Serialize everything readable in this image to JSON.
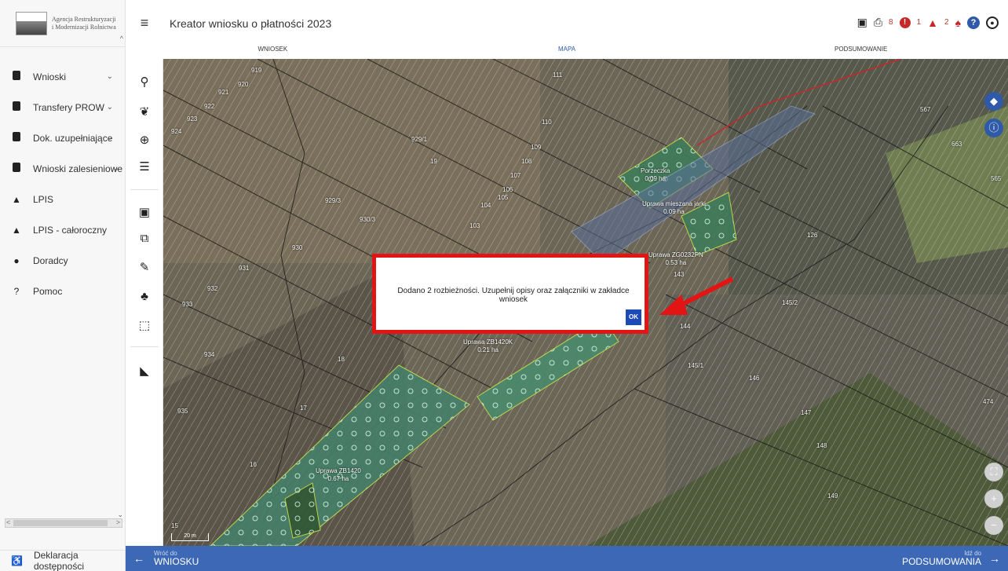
{
  "app": {
    "logo_line1": "Agencja Restrukturyzacji",
    "logo_line2": "i Modernizacji Rolnictwa",
    "page_title": "Kreator wniosku o płatności 2023"
  },
  "sidebar": {
    "items": [
      {
        "label": "Wnioski",
        "icon": "document-icon",
        "has_dropdown": true
      },
      {
        "label": "Transfery PROW",
        "icon": "document-icon",
        "has_dropdown": true
      },
      {
        "label": "Dok. uzupełniające",
        "icon": "document-icon",
        "has_dropdown": true
      },
      {
        "label": "Wnioski zalesieniowe",
        "icon": "document-icon",
        "has_dropdown": true
      },
      {
        "label": "LPIS",
        "icon": "terrain-icon",
        "has_dropdown": false
      },
      {
        "label": "LPIS - całoroczny",
        "icon": "terrain-icon",
        "has_dropdown": false
      },
      {
        "label": "Doradcy",
        "icon": "person-icon",
        "has_dropdown": false
      },
      {
        "label": "Pomoc",
        "icon": "help-icon",
        "has_dropdown": false
      }
    ],
    "footer_link": "Deklaracja dostępności"
  },
  "header": {
    "errors_count": "8",
    "warnings_count": "1",
    "notifications_count": "2"
  },
  "tabs": [
    {
      "label": "WNIOSEK",
      "active": false
    },
    {
      "label": "MAPA",
      "active": true
    },
    {
      "label": "PODSUMOWANIE",
      "active": false
    }
  ],
  "map": {
    "scale": "20 m",
    "parcel_labels": [
      "919",
      "920",
      "921",
      "922",
      "923",
      "924",
      "929/1",
      "111",
      "110",
      "109",
      "108",
      "107",
      "106",
      "105",
      "104",
      "103",
      "19",
      "929/3",
      "930/3",
      "930",
      "931",
      "932",
      "933",
      "934",
      "935",
      "18",
      "17",
      "16",
      "15",
      "126",
      "145/2",
      "144",
      "145/1",
      "146",
      "147",
      "148",
      "149",
      "143",
      "567",
      "565",
      "474",
      "663"
    ],
    "crops": [
      {
        "name": "Porzeczka",
        "area": "0.09 ha"
      },
      {
        "name": "Uprawa mieszana jarki",
        "area": "0.09 ha"
      },
      {
        "name": "Uprawa ZG0232PN",
        "area": "0.53 ha"
      },
      {
        "name": "Uprawa ZB1420K",
        "area": "0.21 ha"
      },
      {
        "name": "Uprawa ZB1420",
        "area": "0.67 ha"
      }
    ]
  },
  "dialog": {
    "message": "Dodano 2 rozbieżności. Uzupełnij opisy oraz załączniki w zakładce wniosek",
    "ok_label": "OK"
  },
  "bottombar": {
    "back_small": "Wróć do",
    "back_big": "WNIOSKU",
    "next_small": "Idź do",
    "next_big": "PODSUMOWANIA"
  },
  "colors": {
    "accent": "#3d68b5",
    "dialog_border": "#e31414",
    "error": "#c62828"
  }
}
